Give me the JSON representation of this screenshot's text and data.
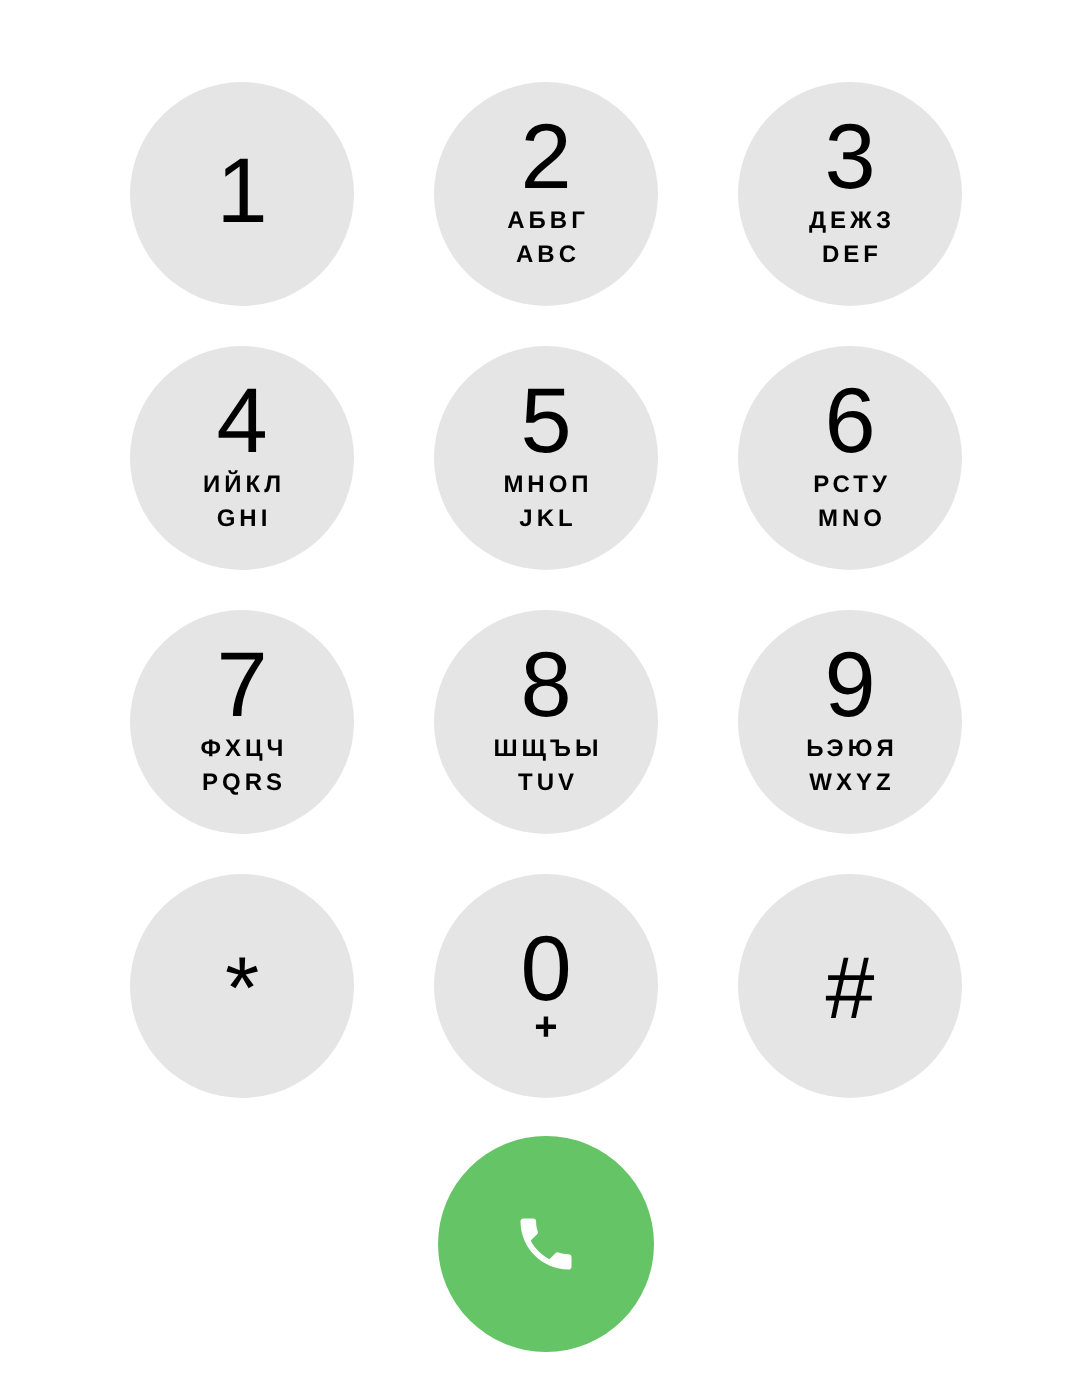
{
  "keys": [
    {
      "kind": "digit",
      "label": "1"
    },
    {
      "kind": "digit",
      "label": "2",
      "letters": [
        "АБВГ",
        "ABC"
      ]
    },
    {
      "kind": "digit",
      "label": "3",
      "letters": [
        "ДЕЖЗ",
        "DEF"
      ]
    },
    {
      "kind": "digit",
      "label": "4",
      "letters": [
        "ИЙКЛ",
        "GHI"
      ]
    },
    {
      "kind": "digit",
      "label": "5",
      "letters": [
        "МНОП",
        "JKL"
      ]
    },
    {
      "kind": "digit",
      "label": "6",
      "letters": [
        "РСТУ",
        "MNO"
      ]
    },
    {
      "kind": "digit",
      "label": "7",
      "letters": [
        "ФХЦЧ",
        "PQRS"
      ]
    },
    {
      "kind": "digit",
      "label": "8",
      "letters": [
        "ШЩЪЫ",
        "TUV"
      ]
    },
    {
      "kind": "digit",
      "label": "9",
      "letters": [
        "ЬЭЮЯ",
        "WXYZ"
      ]
    },
    {
      "kind": "symbol",
      "label": "*"
    },
    {
      "kind": "digit",
      "label": "0",
      "letters": [
        "+"
      ]
    },
    {
      "kind": "symbol",
      "label": "#"
    }
  ],
  "call_button": {
    "kind": "call"
  }
}
